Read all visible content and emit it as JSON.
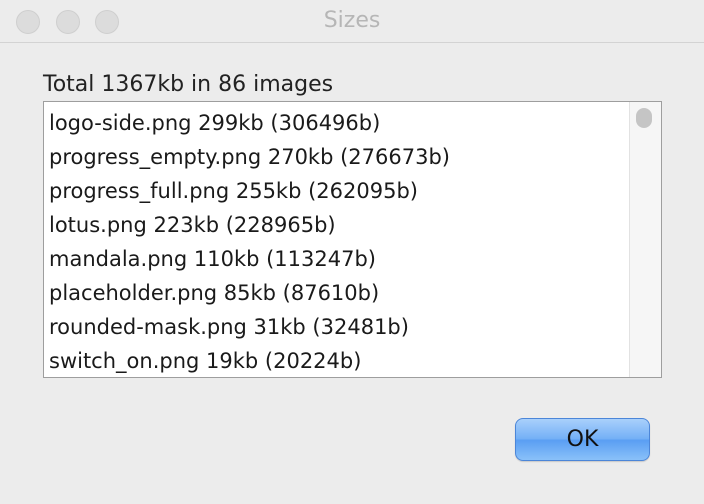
{
  "window": {
    "title": "Sizes"
  },
  "summary": {
    "text": "Total 1367kb in 86 images"
  },
  "files": [
    "logo-side.png 299kb (306496b)",
    "progress_empty.png 270kb (276673b)",
    "progress_full.png 255kb (262095b)",
    "lotus.png 223kb (228965b)",
    "mandala.png 110kb (113247b)",
    "placeholder.png 85kb (87610b)",
    "rounded-mask.png 31kb (32481b)",
    "switch_on.png 19kb (20224b)"
  ],
  "buttons": {
    "ok_label": "OK"
  },
  "colors": {
    "ok_button": "#74b0f6",
    "window_bg": "#ececec"
  }
}
